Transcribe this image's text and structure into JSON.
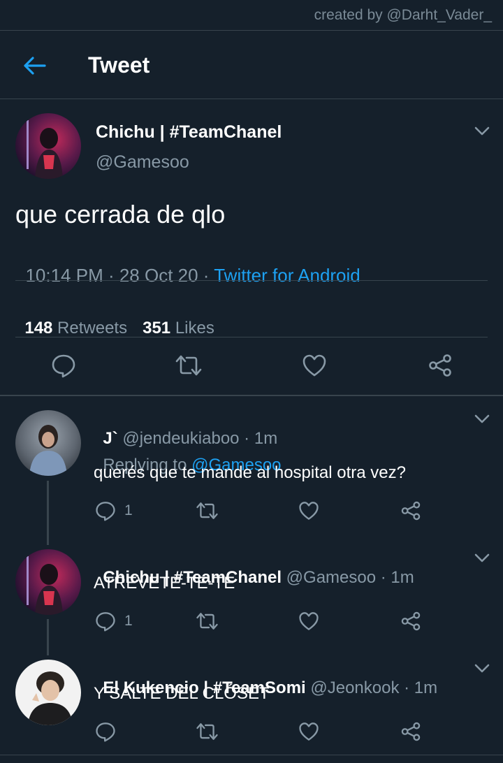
{
  "watermark": "created by @Darht_Vader_",
  "header": {
    "title": "Tweet"
  },
  "tweet": {
    "display_name": "Chichu | #TeamChanel",
    "handle": "@Gamesoo",
    "text": "que cerrada de qlo",
    "time": "10:14 PM · 28 Oct 20 · ",
    "source": "Twitter for Android",
    "retweets_count": "148",
    "retweets_label": " Retweets",
    "likes_count": "351",
    "likes_label": " Likes"
  },
  "replies": [
    {
      "display_name": "J`",
      "handle_time": " @jendeukiaboo · 1m",
      "replying_prefix": "Replying to ",
      "replying_to": "@Gamesoo",
      "text": "querés que te mande al hospital otra vez?",
      "reply_count": "1"
    },
    {
      "display_name": "Chichu | #TeamChanel",
      "handle_time": " @Gamesoo · 1m",
      "text": "ATREVETE-TE-TE",
      "reply_count": "1"
    },
    {
      "display_name": "El Kukencio | #TeamSomi",
      "handle_time": " @Jeonkook · 1m",
      "text": "Y SALTE DEL CLÓSET",
      "reply_count": ""
    }
  ],
  "colors": {
    "background": "#15202b",
    "accent": "#1da1f2",
    "muted": "#8899a6",
    "divider": "#38444d"
  }
}
